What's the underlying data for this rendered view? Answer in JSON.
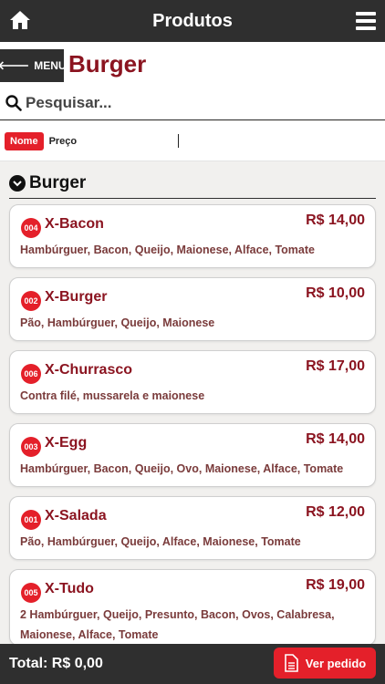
{
  "topbar": {
    "title": "Produtos",
    "home_icon": "home-icon",
    "menu_icon": "hamburger-menu-icon"
  },
  "header": {
    "menu_button": "MENU",
    "page_title": "Burger"
  },
  "search": {
    "placeholder": "Pesquisar..."
  },
  "sort": {
    "active": "Nome",
    "inactive": "Preço"
  },
  "section": {
    "label": "Burger"
  },
  "products": [
    {
      "code": "004",
      "name": "X-Bacon",
      "price": "R$ 14,00",
      "desc": "Hambúrguer, Bacon, Queijo, Maionese, Alface, Tomate"
    },
    {
      "code": "002",
      "name": "X-Burger",
      "price": "R$ 10,00",
      "desc": "Pão, Hambúrguer, Queijo, Maionese"
    },
    {
      "code": "006",
      "name": "X-Churrasco",
      "price": "R$ 17,00",
      "desc": "Contra filé, mussarela e maionese"
    },
    {
      "code": "003",
      "name": "X-Egg",
      "price": "R$ 14,00",
      "desc": "Hambúrguer, Bacon, Queijo, Ovo, Maionese, Alface, Tomate"
    },
    {
      "code": "001",
      "name": "X-Salada",
      "price": "R$ 12,00",
      "desc": "Pão, Hambúrguer, Queijo, Alface, Maionese, Tomate"
    },
    {
      "code": "005",
      "name": "X-Tudo",
      "price": "R$ 19,00",
      "desc": "2 Hambúrguer, Queijo, Presunto, Bacon, Ovos, Calabresa, Maionese, Alface, Tomate"
    }
  ],
  "footer": {
    "total": "Total: R$ 0,00",
    "order_button": "Ver pedido"
  },
  "colors": {
    "accent": "#e4202a",
    "title": "#8b1420",
    "bar": "#2f2f2f"
  }
}
